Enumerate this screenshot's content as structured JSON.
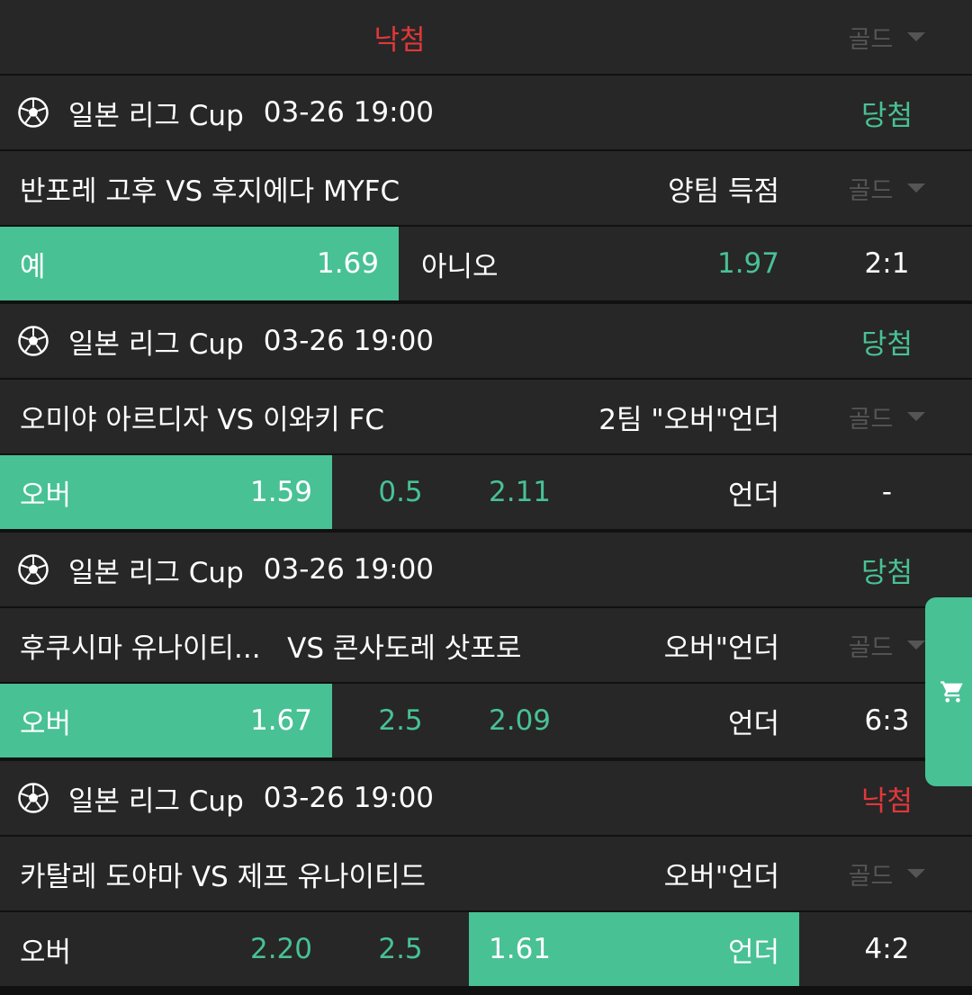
{
  "top_row": {
    "status": "낙첨",
    "gold": "골드"
  },
  "bets": [
    {
      "league": "일본 리그 Cup",
      "datetime": "03-26 19:00",
      "status": "당첨",
      "match": "반포레 고후 VS 후지에다 MYFC",
      "market": "양팀 득점",
      "gold": "골드",
      "opt1_label": "예",
      "opt1_odds": "1.69",
      "opt2_label": "아니오",
      "opt2_odds": "1.97",
      "score": "2:1"
    },
    {
      "league": "일본 리그 Cup",
      "datetime": "03-26 19:00",
      "status": "당첨",
      "match": "오미야 아르디자 VS 이와키 FC",
      "market": "2팀 \"오버\"언더",
      "gold": "골드",
      "over_label": "오버",
      "over_odds": "1.59",
      "line": "0.5",
      "under_odds": "2.11",
      "under_label": "언더",
      "score": "-"
    },
    {
      "league": "일본 리그 Cup",
      "datetime": "03-26 19:00",
      "status": "당첨",
      "match": "후쿠시마 유나이티...   VS 콘사도레 삿포로",
      "market": "오버\"언더",
      "gold": "골드",
      "over_label": "오버",
      "over_odds": "1.67",
      "line": "2.5",
      "under_odds": "2.09",
      "under_label": "언더",
      "score": "6:3"
    },
    {
      "league": "일본 리그 Cup",
      "datetime": "03-26 19:00",
      "status": "낙첨",
      "match": "카탈레 도야마 VS 제프 유나이티드",
      "market": "오버\"언더",
      "gold": "골드",
      "over_label": "오버",
      "over_odds": "2.20",
      "line": "2.5",
      "under_odds": "1.61",
      "under_label": "언더",
      "score": "4:2"
    }
  ],
  "icons": {
    "ball": "soccer-ball-icon",
    "cart": "cart-icon",
    "caret": "chevron-down-icon"
  },
  "colors": {
    "accent": "#48c195",
    "lose": "#e0383a",
    "background": "#272727"
  }
}
